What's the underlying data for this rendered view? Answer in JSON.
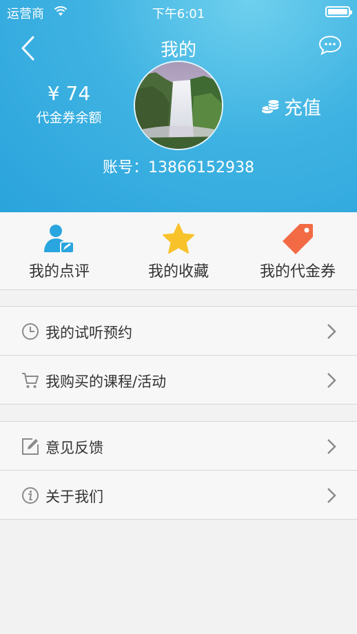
{
  "status_bar": {
    "carrier": "运营商",
    "time": "下午6:01"
  },
  "nav": {
    "title": "我的",
    "back_icon": "chevron-left-icon",
    "message_icon": "chat-bubble-icon"
  },
  "profile": {
    "balance_value": "¥ 74",
    "balance_label": "代金券余额",
    "recharge_label": "充值",
    "recharge_icon": "coins-icon",
    "account_text": "账号：13866152938"
  },
  "quick_actions": [
    {
      "label": "我的点评",
      "icon": "user-review-icon",
      "color": "#29a5df"
    },
    {
      "label": "我的收藏",
      "icon": "star-icon",
      "color": "#f8c22b"
    },
    {
      "label": "我的代金券",
      "icon": "tag-icon",
      "color": "#f26b44"
    }
  ],
  "menu_groups": [
    {
      "items": [
        {
          "label": "我的试听预约",
          "icon": "clock-icon"
        },
        {
          "label": "我购买的课程/活动",
          "icon": "cart-icon"
        }
      ]
    },
    {
      "items": [
        {
          "label": "意见反馈",
          "icon": "edit-icon"
        },
        {
          "label": "关于我们",
          "icon": "info-icon"
        }
      ]
    }
  ],
  "colors": {
    "header_blue": "#3fb3e2",
    "background": "#f2f2f2",
    "text": "#333333",
    "icon_gray": "#8a8a8a"
  }
}
